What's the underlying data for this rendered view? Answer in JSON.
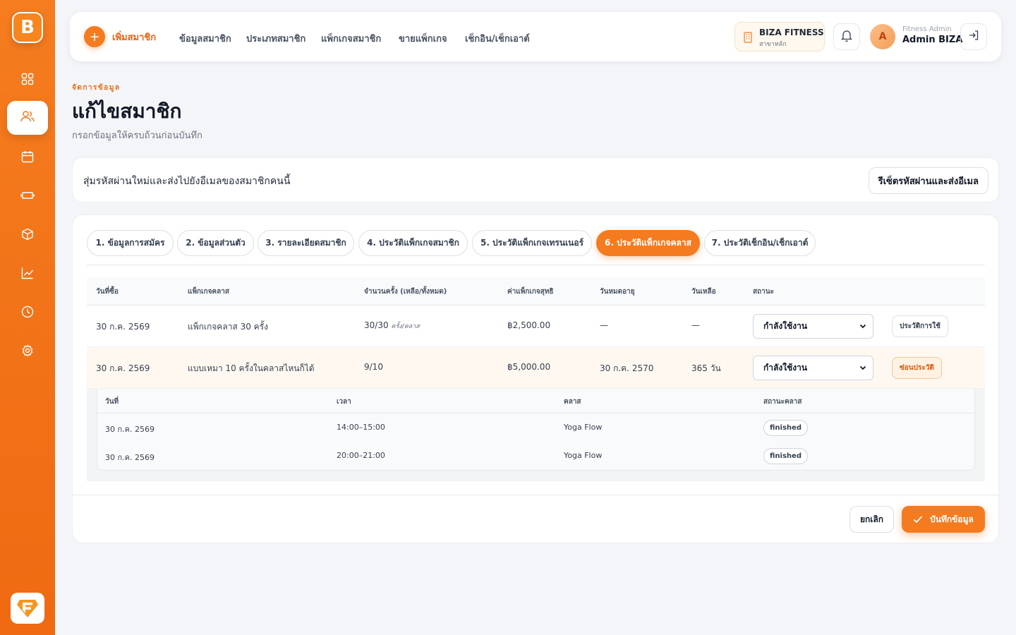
{
  "brand": {
    "logo_letter": "B",
    "accent": "#f47b20"
  },
  "sidebar": {
    "items": [
      {
        "name": "grid-icon"
      },
      {
        "name": "users-icon",
        "active": true
      },
      {
        "name": "calendar-icon"
      },
      {
        "name": "ticket-icon"
      },
      {
        "name": "box-icon"
      },
      {
        "name": "chart-icon"
      },
      {
        "name": "clock-icon"
      },
      {
        "name": "settings-icon"
      }
    ]
  },
  "topbar": {
    "add_label": "เพิ่มสมาชิก",
    "nav": [
      "ข้อมูลสมาชิก",
      "ประเภทสมาชิก",
      "แพ็กเกจสมาชิก",
      "ขายแพ็กเกจ",
      "เช็กอิน/เช็กเอาต์"
    ],
    "branch_name": "BIZA FITNESS",
    "branch_sub": "สาขาหลัก",
    "avatar_letter": "A",
    "user_role": "Fitness Admin",
    "user_name": "Admin BIZA"
  },
  "header": {
    "eyebrow": "จัดการข้อมูล",
    "title": "แก้ไขสมาชิก",
    "subtitle": "กรอกข้อมูลให้ครบถ้วนก่อนบันทึก"
  },
  "reset": {
    "text": "สุ่มรหัสผ่านใหม่และส่งไปยังอีเมลของสมาชิกคนนี้",
    "button": "รีเซ็ตรหัสผ่านและส่งอีเมล"
  },
  "tabs": [
    "1. ข้อมูลการสมัคร",
    "2. ข้อมูลส่วนตัว",
    "3. รายละเอียดสมาชิก",
    "4. ประวัติแพ็กเกจสมาชิก",
    "5. ประวัติแพ็กเกจเทรนเนอร์",
    "6. ประวัติแพ็กเกจคลาส",
    "7. ประวัติเช็กอิน/เช็กเอาต์"
  ],
  "active_tab": 5,
  "table": {
    "headers": [
      "วันที่ซื้อ",
      "แพ็กเกจคลาส",
      "จำนวนครั้ง (เหลือ/ทั้งหมด)",
      "ค่าแพ็กเกจสุทธิ",
      "วันหมดอายุ",
      "วันเหลือ",
      "สถานะ"
    ],
    "rows": [
      {
        "date": "30 ก.ค. 2569",
        "package": "แพ็กเกจคลาส 30 ครั้ง",
        "count": "30/30",
        "count_unit": "ครั้ง/คลาส",
        "price": "฿2,500.00",
        "expire": "—",
        "days_left": "—",
        "status": "กำลังใช้งาน",
        "action": "ประวัติการใช้"
      },
      {
        "date": "30 ก.ค. 2569",
        "package": "แบบเหมา 10 ครั้งในคลาสไหนก็ได้",
        "count": "9/10",
        "count_unit": "",
        "price": "฿5,000.00",
        "expire": "30 ก.ค. 2570",
        "days_left": "365 วัน",
        "status": "กำลังใช้งาน",
        "action": "ซ่อนประวัติ"
      }
    ]
  },
  "usage": {
    "headers": [
      "วันที่",
      "เวลา",
      "คลาส",
      "สถานะคลาส"
    ],
    "rows": [
      {
        "date": "30 ก.ค. 2569",
        "time": "14:00–15:00",
        "class": "Yoga Flow",
        "status": "finished"
      },
      {
        "date": "30 ก.ค. 2569",
        "time": "20:00–21:00",
        "class": "Yoga Flow",
        "status": "finished"
      }
    ]
  },
  "footer": {
    "cancel": "ยกเลิก",
    "save": "บันทึกข้อมูล"
  }
}
